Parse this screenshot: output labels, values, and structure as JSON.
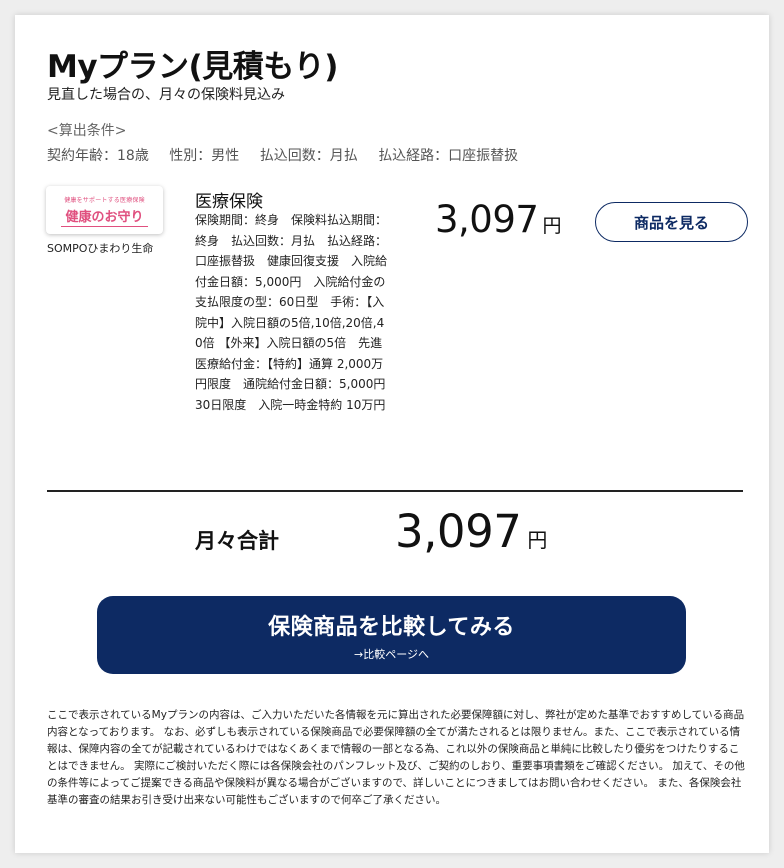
{
  "header": {
    "title": "Myプラン(見積もり)",
    "subtitle": "見直した場合の、月々の保険料見込み"
  },
  "conditions": {
    "label": "<算出条件>",
    "age": "契約年齢：18歳",
    "gender": "性別：男性",
    "payment_count": "払込回数：月払",
    "payment_route": "払込経路：口座振替扱"
  },
  "product": {
    "logo_sub": "健康をサポートする医療保険",
    "logo_main": "健康のお守り",
    "company": "SOMPOひまわり生命",
    "name": "医療保険",
    "description": "保険期間：終身　保険料払込期間：終身　払込回数：月払　払込経路：口座振替扱　健康回復支援　入院給付金日額：5,000円　入院給付金の支払限度の型：60日型　手術：【入院中】入院日額の5倍,10倍,20倍,40倍 【外来】入院日額の5倍　先進医療給付金：【特約】通算 2,000万円限度　通院給付金日額：5,000円　30日限度　入院一時金特約 10万円",
    "price": "3,097",
    "currency": "円",
    "detail_button": "商品を見る"
  },
  "total": {
    "label": "月々合計",
    "price": "3,097",
    "currency": "円"
  },
  "compare": {
    "label": "保険商品を比較してみる",
    "sublabel": "→比較ページへ"
  },
  "disclaimer": "ここで表示されているMyプランの内容は、ご入力いただいた各情報を元に算出された必要保障額に対し、弊社が定めた基準でおすすめしている商品内容となっております。 なお、必ずしも表示されている保険商品で必要保障額の全てが満たされるとは限りません。また、ここで表示されている情報は、保障内容の全てが記載されているわけではなくあくまで情報の一部となる為、これ以外の保険商品と単純に比較したり優劣をつけたりすることはできません。 実際にご検討いただく際には各保険会社のパンフレット及び、ご契約のしおり、重要事項書類をご確認ください。 加えて、その他の条件等によってご提案できる商品や保険料が異なる場合がございますので、詳しいことにつきましてはお問い合わせください。 また、各保険会社基準の審査の結果お引き受け出来ない可能性もございますので何卒ご了承ください。",
  "colors": {
    "navy": "#0d2a63",
    "logo_pink": "#e0507f",
    "background": "#eeeeee"
  }
}
